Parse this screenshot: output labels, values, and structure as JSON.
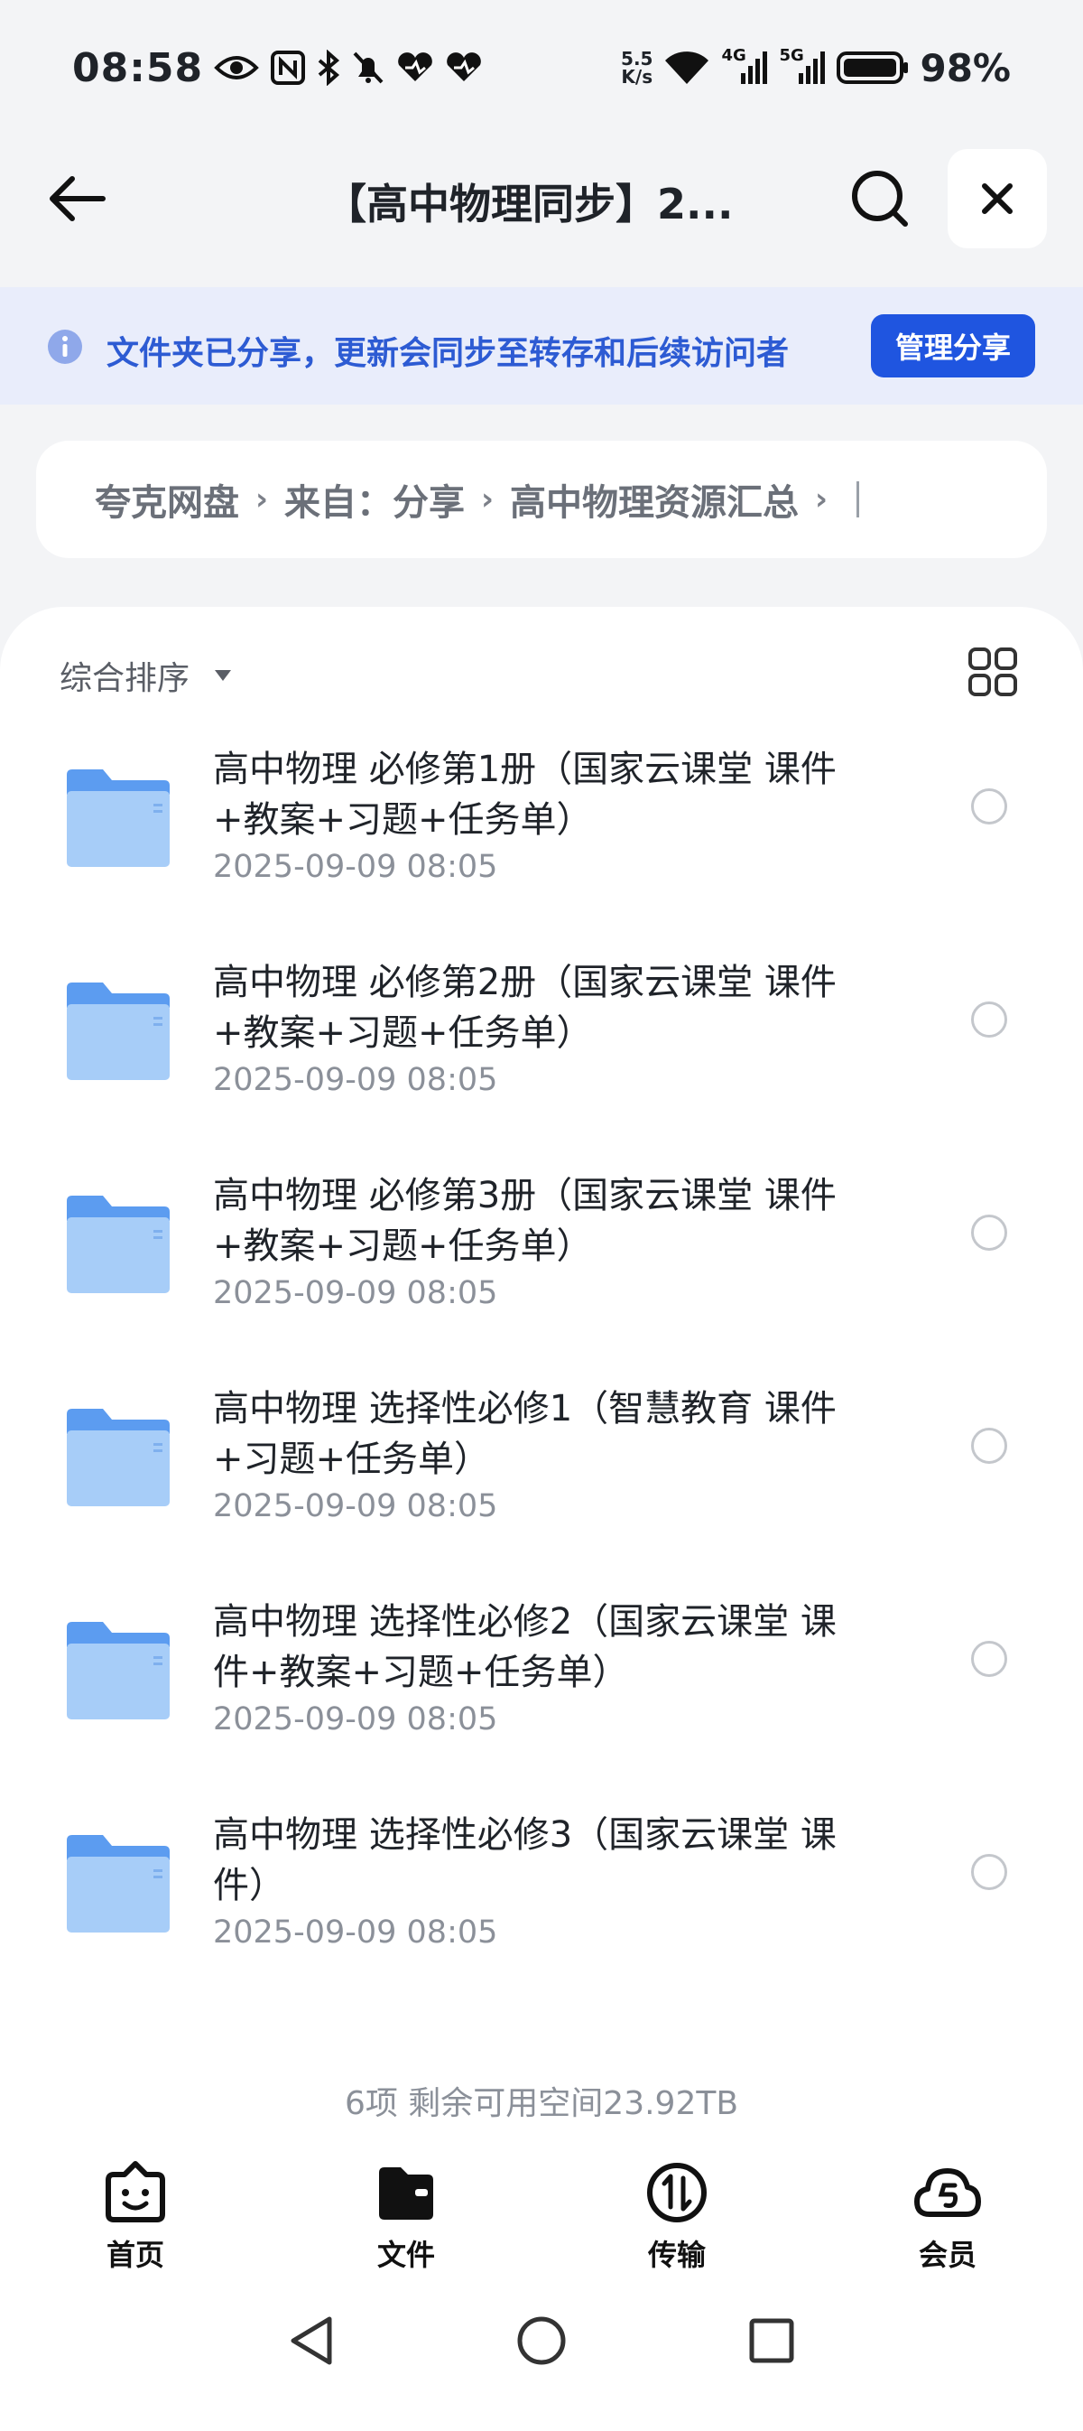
{
  "status": {
    "time": "08:58",
    "net_speed_top": "5.5",
    "net_speed_bottom": "K/s",
    "signal1": "4G",
    "signal2": "5G",
    "battery": "98%"
  },
  "header": {
    "title": "【高中物理同步】2...",
    "icons": {
      "back": "arrow-left-icon",
      "search": "search-icon",
      "close": "close-icon"
    }
  },
  "notice": {
    "text": "文件夹已分享，更新会同步至转存和后续访问者",
    "button": "管理分享",
    "accent": "#1f55e0"
  },
  "breadcrumb": [
    "夸克网盘",
    "来自：分享",
    "高中物理资源汇总"
  ],
  "sort": {
    "label": "综合排序"
  },
  "files": [
    {
      "name": "高中物理 必修第1册（国家云课堂 课件+教案+习题+任务单）",
      "date": "2025-09-09 08:05"
    },
    {
      "name": "高中物理 必修第2册（国家云课堂 课件+教案+习题+任务单）",
      "date": "2025-09-09 08:05"
    },
    {
      "name": "高中物理 必修第3册（国家云课堂 课件+教案+习题+任务单）",
      "date": "2025-09-09 08:05"
    },
    {
      "name": "高中物理 选择性必修1（智慧教育 课件+习题+任务单）",
      "date": "2025-09-09 08:05"
    },
    {
      "name": "高中物理 选择性必修2（国家云课堂 课件+教案+习题+任务单）",
      "date": "2025-09-09 08:05"
    },
    {
      "name": "高中物理 选择性必修3（国家云课堂 课件）",
      "date": "2025-09-09 08:05"
    }
  ],
  "footer": {
    "summary": "6项 剩余可用空间23.92TB"
  },
  "nav": [
    {
      "label": "首页",
      "icon": "home-face-icon"
    },
    {
      "label": "文件",
      "icon": "folder-wallet-icon"
    },
    {
      "label": "传输",
      "icon": "transfer-icon"
    },
    {
      "label": "会员",
      "icon": "vip-cloud-icon"
    }
  ]
}
